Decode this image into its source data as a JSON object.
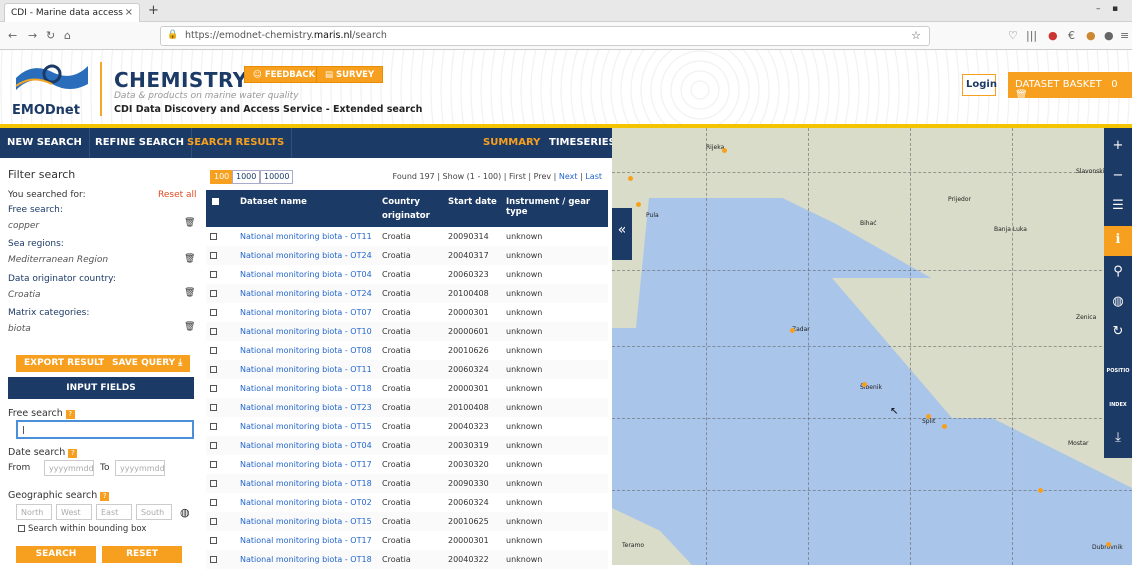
{
  "browser": {
    "tab_title": "CDI - Marine data access",
    "url_prefix": "https://emodnet-chemistry.",
    "url_domain": "maris.nl",
    "url_suffix": "/search"
  },
  "header": {
    "logo_text": "EMODnet",
    "brand": "CHEMISTRY",
    "tagline": "Data & products on marine water quality",
    "subtitle": "CDI Data Discovery and Access Service - Extended search",
    "feedback": "FEEDBACK",
    "survey": "SURVEY",
    "login": "Login",
    "basket": "DATASET BASKET",
    "basket_count": "0"
  },
  "nav": {
    "new_search": "NEW SEARCH",
    "refine": "REFINE SEARCH",
    "results": "SEARCH RESULTS",
    "summary": "SUMMARY",
    "timeseries": "TIMESERIES"
  },
  "filter": {
    "title": "Filter search",
    "you_searched": "You searched for:",
    "reset_all": "Reset all",
    "items": [
      {
        "label": "Free search:",
        "value": "copper"
      },
      {
        "label": "Sea regions:",
        "value": "Mediterranean Region"
      },
      {
        "label": "Data originator country:",
        "value": "Croatia"
      },
      {
        "label": "Matrix categories:",
        "value": "biota"
      }
    ],
    "export": "EXPORT RESULT",
    "save": "SAVE QUERY"
  },
  "input": {
    "header": "INPUT FIELDS",
    "free_search": "Free search",
    "date_search": "Date search",
    "from": "From",
    "to": "To",
    "date_ph": "yyyymmdd",
    "geo": "Geographic search",
    "north": "North",
    "west": "West",
    "east": "East",
    "south": "South",
    "bbox": "Search within bounding box",
    "search": "SEARCH",
    "reset": "RESET"
  },
  "results": {
    "pages": [
      "100",
      "1000",
      "10000"
    ],
    "found": "Found 197 | Show (1 - 100) | First | Prev |",
    "next": "Next",
    "last": "Last",
    "cols": [
      "Dataset name",
      "Country",
      "originator",
      "Start date",
      "Instrument / gear type"
    ],
    "rows": [
      [
        "National monitoring biota - OT11",
        "Croatia",
        "20090314",
        "unknown"
      ],
      [
        "National monitoring biota - OT24",
        "Croatia",
        "20040317",
        "unknown"
      ],
      [
        "National monitoring biota - OT04",
        "Croatia",
        "20060323",
        "unknown"
      ],
      [
        "National monitoring biota - OT24",
        "Croatia",
        "20100408",
        "unknown"
      ],
      [
        "National monitoring biota - OT07",
        "Croatia",
        "20000301",
        "unknown"
      ],
      [
        "National monitoring biota - OT10",
        "Croatia",
        "20000601",
        "unknown"
      ],
      [
        "National monitoring biota - OT08",
        "Croatia",
        "20010626",
        "unknown"
      ],
      [
        "National monitoring biota - OT11",
        "Croatia",
        "20060324",
        "unknown"
      ],
      [
        "National monitoring biota - OT18",
        "Croatia",
        "20000301",
        "unknown"
      ],
      [
        "National monitoring biota - OT23",
        "Croatia",
        "20100408",
        "unknown"
      ],
      [
        "National monitoring biota - OT15",
        "Croatia",
        "20040323",
        "unknown"
      ],
      [
        "National monitoring biota - OT04",
        "Croatia",
        "20030319",
        "unknown"
      ],
      [
        "National monitoring biota - OT17",
        "Croatia",
        "20030320",
        "unknown"
      ],
      [
        "National monitoring biota - OT18",
        "Croatia",
        "20090330",
        "unknown"
      ],
      [
        "National monitoring biota - OT02",
        "Croatia",
        "20060324",
        "unknown"
      ],
      [
        "National monitoring biota - OT15",
        "Croatia",
        "20010625",
        "unknown"
      ],
      [
        "National monitoring biota - OT17",
        "Croatia",
        "20000301",
        "unknown"
      ],
      [
        "National monitoring biota - OT18",
        "Croatia",
        "20040322",
        "unknown"
      ]
    ]
  },
  "map": {
    "towns": [
      "Rijeka",
      "Pula",
      "Slavonski Brod",
      "Prijedor",
      "Bihać",
      "Banja Luka",
      "Zenica",
      "Zadar",
      "Šibenik",
      "Split",
      "Mostar",
      "Teramo",
      "Dubrovnik"
    ],
    "tools": [
      "POSITIO",
      "INDEX"
    ]
  }
}
